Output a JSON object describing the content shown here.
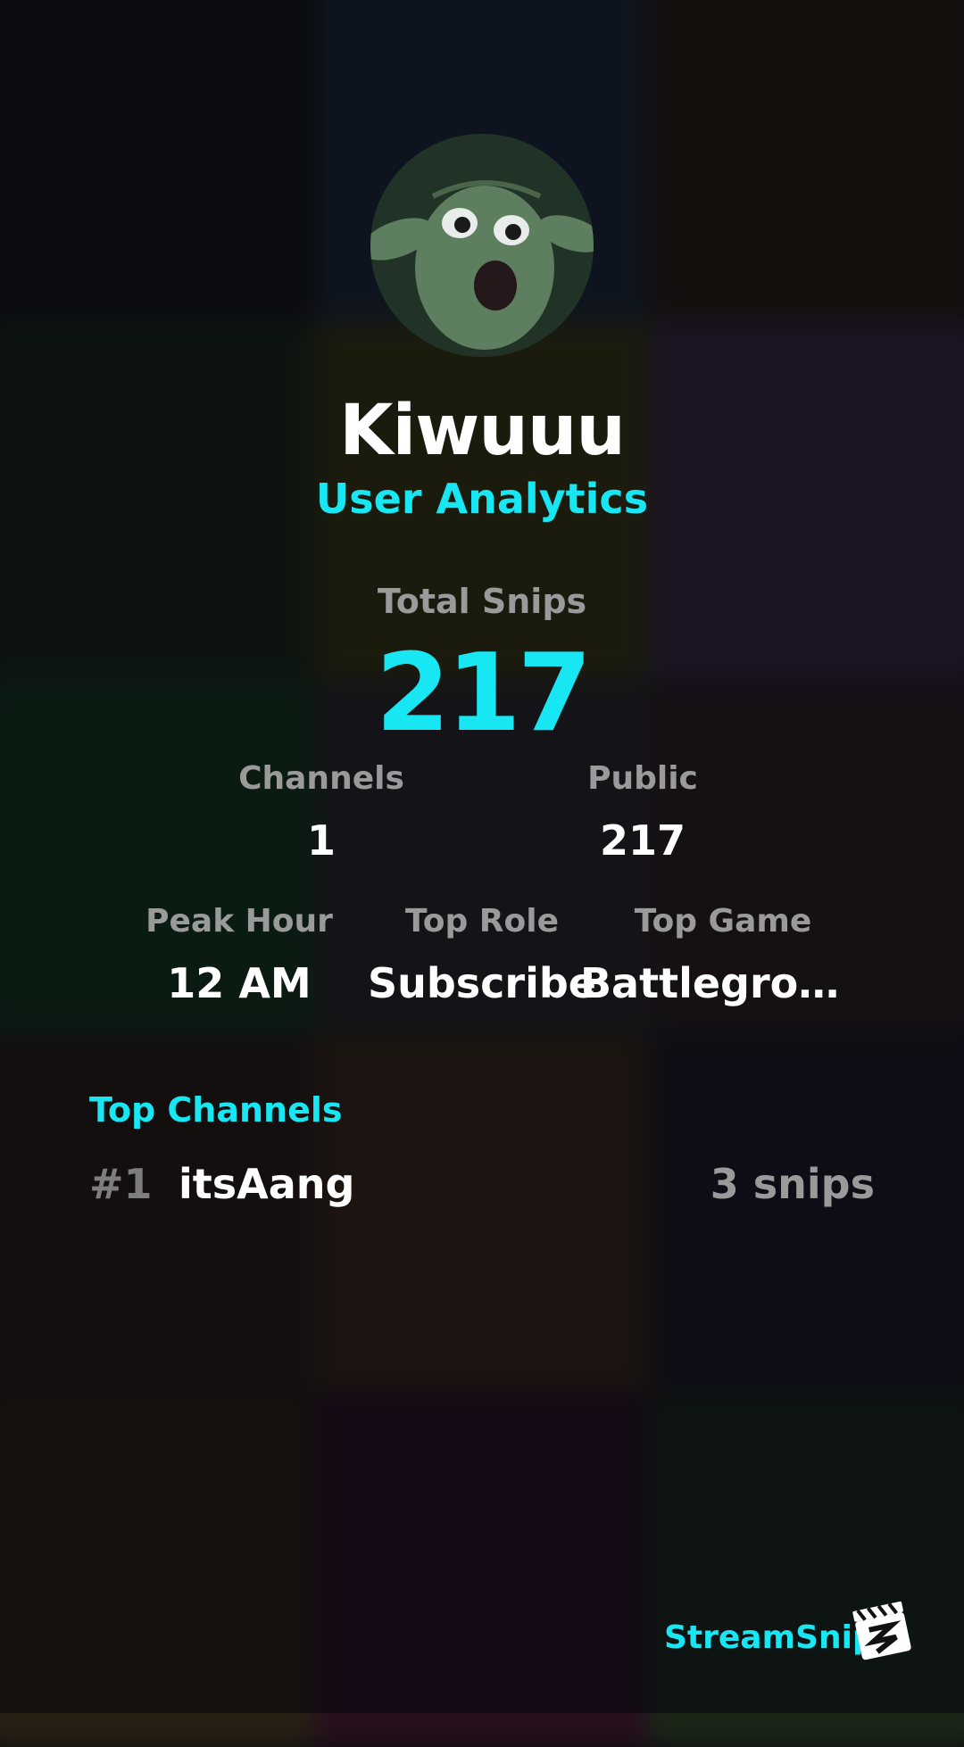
{
  "profile": {
    "username": "Kiwuuu",
    "subtitle": "User Analytics",
    "avatar_icon": "yoda-avatar"
  },
  "totals": {
    "total_label": "Total Snips",
    "total_value": "217"
  },
  "stats_row1": {
    "channels_label": "Channels",
    "channels_value": "1",
    "public_label": "Public",
    "public_value": "217"
  },
  "stats_row2": {
    "peak_label": "Peak Hour",
    "peak_value": "12 AM",
    "role_label": "Top Role",
    "role_value": "Subscribe",
    "game_label": "Top Game",
    "game_value": "Battleground.."
  },
  "top_channels": {
    "title": "Top Channels",
    "items": [
      {
        "rank": "#1",
        "name": "itsAang",
        "count": "3 snips"
      }
    ]
  },
  "brand": {
    "name": "StreamSnip",
    "logo_icon": "clapperboard-icon"
  },
  "colors": {
    "accent": "#18e6f2",
    "muted": "#9a9a9a",
    "text": "#ffffff"
  }
}
